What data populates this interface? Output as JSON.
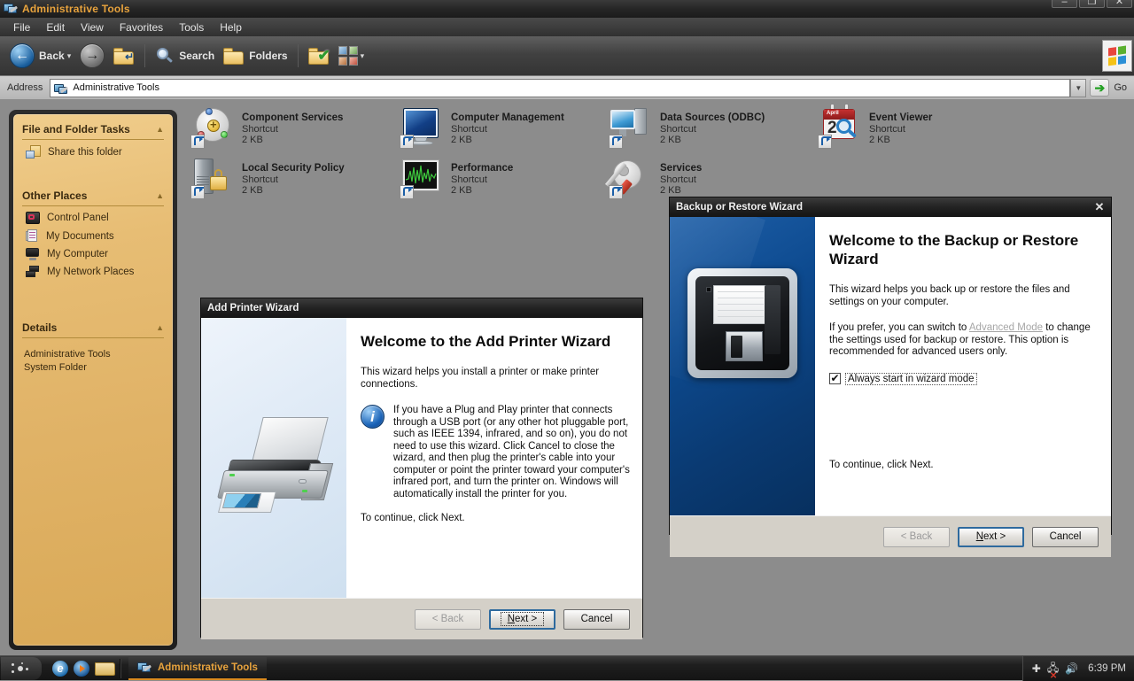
{
  "window": {
    "title": "Administrative Tools",
    "title_icon": "admin-tools-icon",
    "controls": {
      "minimize": "–",
      "maximize": "❐",
      "close": "✕"
    }
  },
  "menubar": {
    "items": [
      "File",
      "Edit",
      "View",
      "Favorites",
      "Tools",
      "Help"
    ]
  },
  "toolbar": {
    "back_label": "Back",
    "back_icon": "back-arrow-icon",
    "forward_icon": "forward-arrow-icon",
    "up_icon": "up-folder-icon",
    "search_label": "Search",
    "search_icon": "magnifier-icon",
    "folders_label": "Folders",
    "folders_icon": "folder-icon",
    "folder_check_icon": "folder-check-icon",
    "views_icon": "views-thumbnail-icon",
    "windows_logo_icon": "windows-flag-logo"
  },
  "address": {
    "label": "Address",
    "value": "Administrative Tools",
    "icon": "admin-tools-icon",
    "dropdown_icon": "chevron-down-icon",
    "go_label": "Go",
    "go_icon": "green-arrow-icon"
  },
  "sidebar": {
    "sections": [
      {
        "title": "File and Folder Tasks",
        "chevron": "▲",
        "items": [
          {
            "label": "Share this folder",
            "icon": "share-folder-icon"
          }
        ]
      },
      {
        "title": "Other Places",
        "chevron": "▲",
        "items": [
          {
            "label": "Control Panel",
            "icon": "control-panel-icon"
          },
          {
            "label": "My Documents",
            "icon": "my-documents-icon"
          },
          {
            "label": "My Computer",
            "icon": "my-computer-icon"
          },
          {
            "label": "My Network Places",
            "icon": "my-network-places-icon"
          }
        ]
      },
      {
        "title": "Details",
        "chevron": "▲",
        "detail_line1": "Administrative Tools",
        "detail_line2": "System Folder"
      }
    ]
  },
  "files": [
    {
      "name": "Component Services",
      "type": "Shortcut",
      "size": "2 KB",
      "icon": "component-services-icon"
    },
    {
      "name": "Computer Management",
      "type": "Shortcut",
      "size": "2 KB",
      "icon": "computer-management-icon"
    },
    {
      "name": "Data Sources (ODBC)",
      "type": "Shortcut",
      "size": "2 KB",
      "icon": "data-sources-icon"
    },
    {
      "name": "Event Viewer",
      "type": "Shortcut",
      "size": "2 KB",
      "icon": "event-viewer-icon"
    },
    {
      "name": "Local Security Policy",
      "type": "Shortcut",
      "size": "2 KB",
      "icon": "local-security-policy-icon"
    },
    {
      "name": "Performance",
      "type": "Shortcut",
      "size": "2 KB",
      "icon": "performance-icon"
    },
    {
      "name": "Services",
      "type": "Shortcut",
      "size": "2 KB",
      "icon": "services-icon"
    }
  ],
  "printer_wizard": {
    "title": "Add Printer Wizard",
    "heading": "Welcome to the Add Printer Wizard",
    "paragraph1": "This wizard helps you install a printer or make printer connections.",
    "note_icon": "info-icon",
    "note": "If you have a Plug and Play printer that connects through a USB port (or any other hot pluggable port, such as IEEE 1394, infrared, and so on), you do not need to use this wizard. Click Cancel to close the wizard, and then plug the printer's cable into your computer or point the printer toward your computer's infrared port, and turn the printer on. Windows will automatically install the printer for you.",
    "paragraph2": "To continue, click Next.",
    "illustration_icon": "printer-illustration",
    "buttons": {
      "back": "< Back",
      "next": "Next >",
      "cancel": "Cancel"
    }
  },
  "backup_wizard": {
    "title": "Backup or Restore Wizard",
    "close_icon": "close-icon",
    "heading": "Welcome to the Backup or Restore Wizard",
    "paragraph1": "This wizard helps you back up or restore the files and settings on your computer.",
    "paragraph2_before": "If you prefer, you can switch to ",
    "advanced_link": "Advanced Mode",
    "paragraph2_after": " to change the settings used for backup or restore. This option is recommended for advanced users only.",
    "checkbox": {
      "label": "Always start in wizard mode",
      "checked": true,
      "mark": "✔"
    },
    "paragraph3": "To continue, click Next.",
    "illustration_icon": "floppy-disk-illustration",
    "buttons": {
      "back": "< Back",
      "next": "Next >",
      "cancel": "Cancel"
    }
  },
  "taskbar": {
    "start_icon": "start-orb-icon",
    "quicklaunch": [
      {
        "icon": "internet-explorer-icon",
        "label": "e"
      },
      {
        "icon": "windows-media-player-icon",
        "label": ""
      },
      {
        "icon": "show-desktop-folder-icon",
        "label": ""
      }
    ],
    "task": {
      "label": "Administrative Tools",
      "icon": "admin-tools-icon"
    },
    "tray": {
      "bluetooth_icon": "bluetooth-icon",
      "network_icon": "network-disconnected-icon",
      "volume_icon": "volume-icon",
      "time": "6:39 PM"
    }
  },
  "colors": {
    "accent_orange": "#e8a33d",
    "sidebar_gold": "#e7bd74",
    "backup_blue": "#0d4a8f",
    "link_disabled": "#a6a6a6"
  }
}
